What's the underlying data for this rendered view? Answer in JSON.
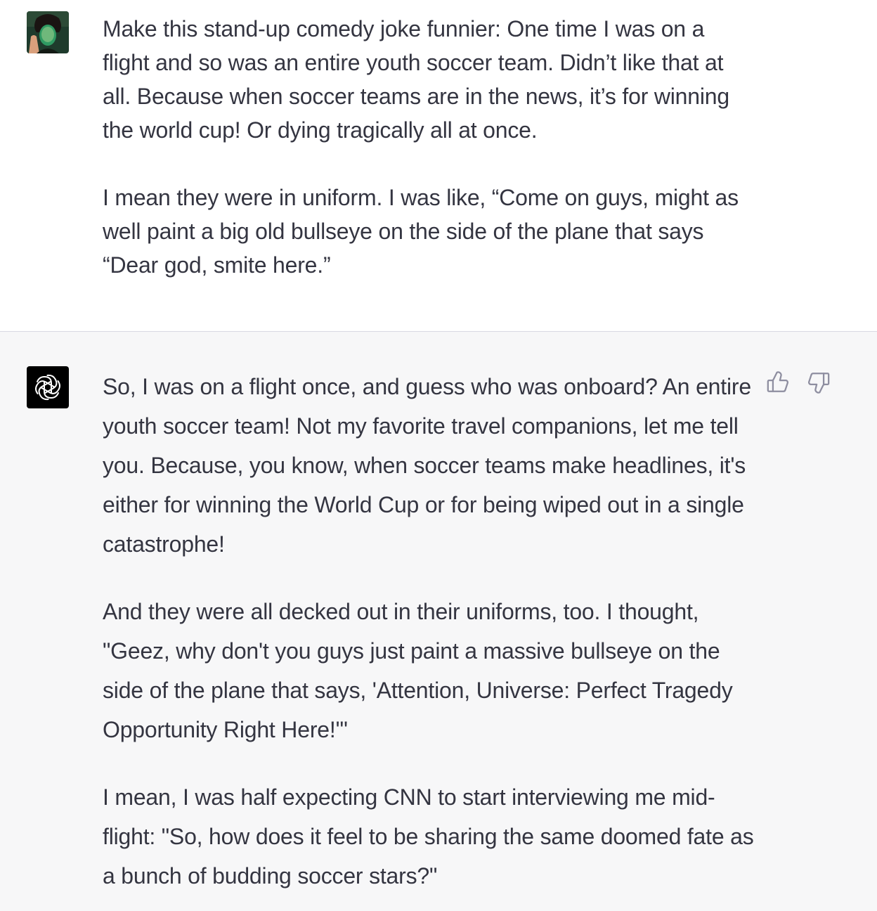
{
  "conversation": {
    "user_turn": {
      "avatar_icon": "user-avatar-photo",
      "paragraphs": [
        "Make this stand-up comedy joke funnier: One time I was on a flight and so was an entire youth soccer team. Didn’t like that at all. Because when soccer teams are in the news, it’s for winning the world cup! Or dying tragically all at once.",
        "I mean they were in uniform. I was like, “Come on guys, might as well paint a big old bullseye on the side of the plane that says “Dear god, smite here.”"
      ]
    },
    "assistant_turn": {
      "avatar_icon": "openai-logo-icon",
      "paragraphs": [
        "So, I was on a flight once, and guess who was onboard? An entire youth soccer team! Not my favorite travel companions, let me tell you. Because, you know, when soccer teams make headlines, it's either for winning the World Cup or for being wiped out in a single catastrophe!",
        "And they were all decked out in their uniforms, too. I thought, \"Geez, why don't you guys just paint a massive bullseye on the side of the plane that says, 'Attention, Universe: Perfect Tragedy Opportunity Right Here!'\"",
        "I mean, I was half expecting CNN to start interviewing me mid-flight: \"So, how does it feel to be sharing the same doomed fate as a bunch of budding soccer stars?\""
      ]
    },
    "feedback": {
      "thumbs_up_icon": "thumbs-up-icon",
      "thumbs_down_icon": "thumbs-down-icon"
    }
  },
  "colors": {
    "text": "#343541",
    "user_bg": "#ffffff",
    "assistant_bg": "#f7f7f8",
    "divider": "#d9d9e3",
    "icon": "#8e8ea0"
  }
}
